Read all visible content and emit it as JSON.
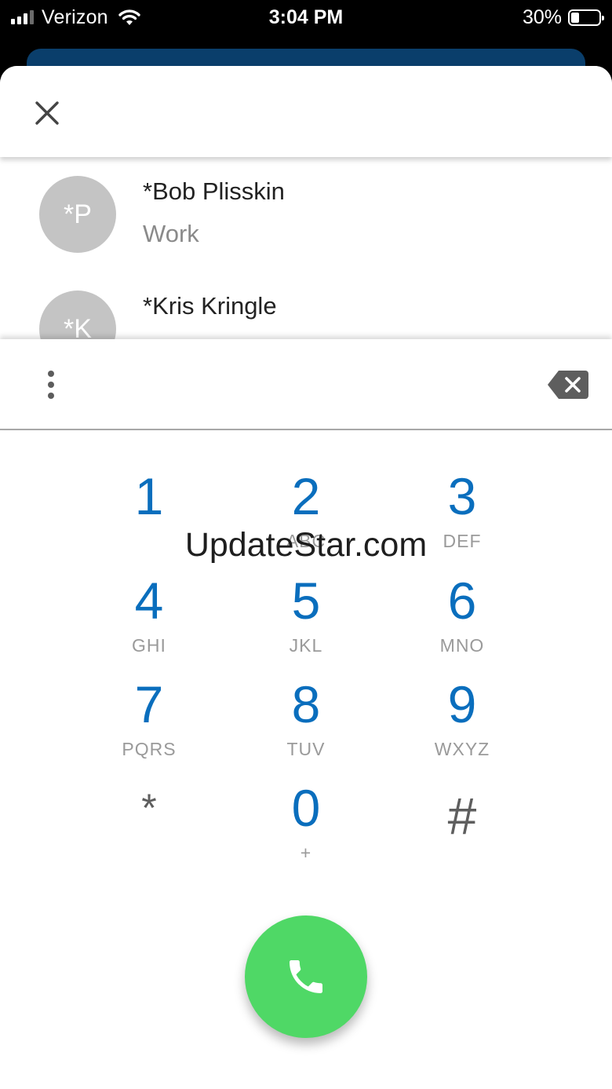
{
  "status_bar": {
    "carrier": "Verizon",
    "time": "3:04 PM",
    "battery_percent": "30%",
    "battery_level": 0.3,
    "signal_bars": 3,
    "signal_bars_total": 4
  },
  "header": {
    "close_icon": "close-icon"
  },
  "contacts": [
    {
      "initials": "*P",
      "name": "*Bob Plisskin",
      "type": "Work"
    },
    {
      "initials": "*K",
      "name": "*Kris Kringle",
      "type": ""
    }
  ],
  "dial_input": {
    "value": "",
    "more_icon": "more-vertical-icon",
    "backspace_icon": "backspace-icon"
  },
  "keypad": {
    "keys": [
      {
        "digit": "1",
        "letters": ""
      },
      {
        "digit": "2",
        "letters": "ABC"
      },
      {
        "digit": "3",
        "letters": "DEF"
      },
      {
        "digit": "4",
        "letters": "GHI"
      },
      {
        "digit": "5",
        "letters": "JKL"
      },
      {
        "digit": "6",
        "letters": "MNO"
      },
      {
        "digit": "7",
        "letters": "PQRS"
      },
      {
        "digit": "8",
        "letters": "TUV"
      },
      {
        "digit": "9",
        "letters": "WXYZ"
      },
      {
        "digit": "*",
        "letters": ""
      },
      {
        "digit": "0",
        "letters": "+"
      },
      {
        "digit": "#",
        "letters": ""
      }
    ]
  },
  "watermark": "UpdateStar.com",
  "call_button": {
    "icon": "phone-icon"
  },
  "colors": {
    "accent": "#0a6ebd",
    "call": "#4fd866",
    "avatar": "#c4c4c4",
    "app_bar": "#0a3e6b"
  }
}
